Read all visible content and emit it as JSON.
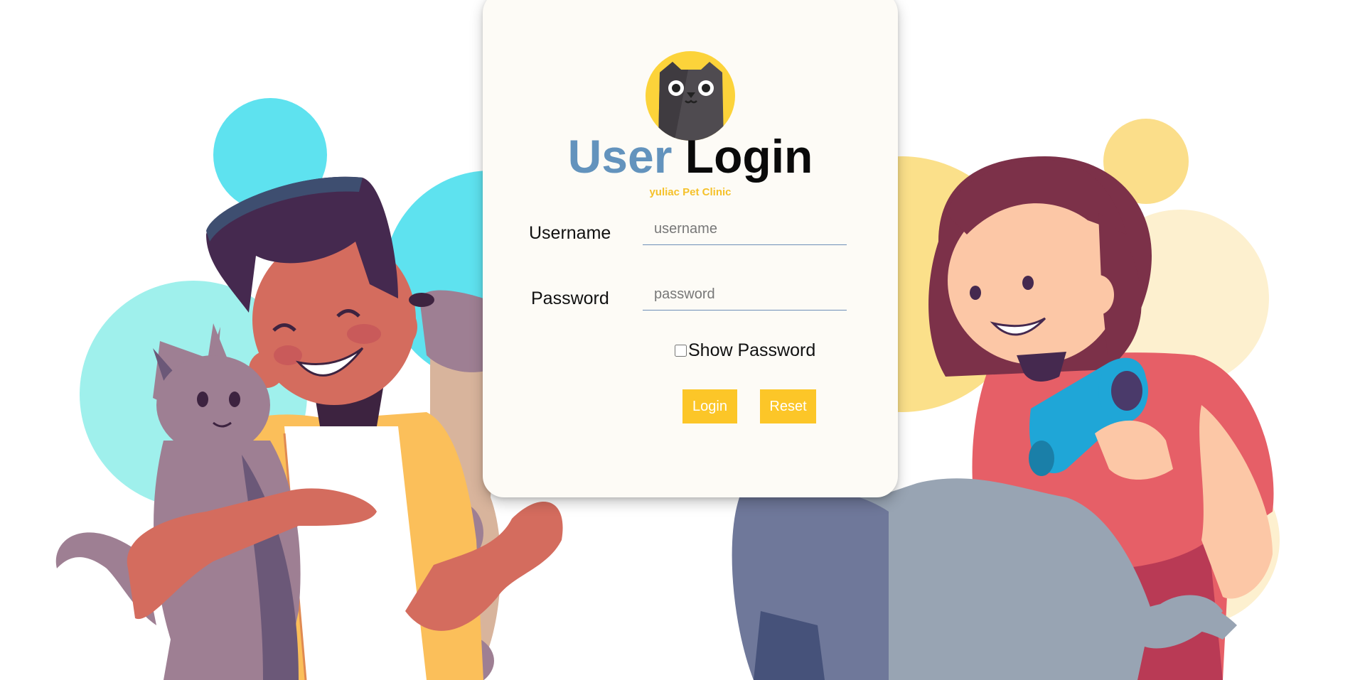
{
  "login": {
    "title_part1": "User",
    "title_part2": "Login",
    "subtitle": "yuliac Pet Clinic",
    "username_label": "Username",
    "username_placeholder": "username",
    "username_value": "",
    "password_label": "Password",
    "password_placeholder": "password",
    "password_value": "",
    "show_password_label": "Show Password",
    "show_password_checked": false,
    "login_button": "Login",
    "reset_button": "Reset"
  },
  "logo": {
    "icon": "black-cat-icon"
  },
  "colors": {
    "accent_blue": "#6393bd",
    "accent_yellow": "#fcc628",
    "card_bg": "#fdfbf6"
  }
}
